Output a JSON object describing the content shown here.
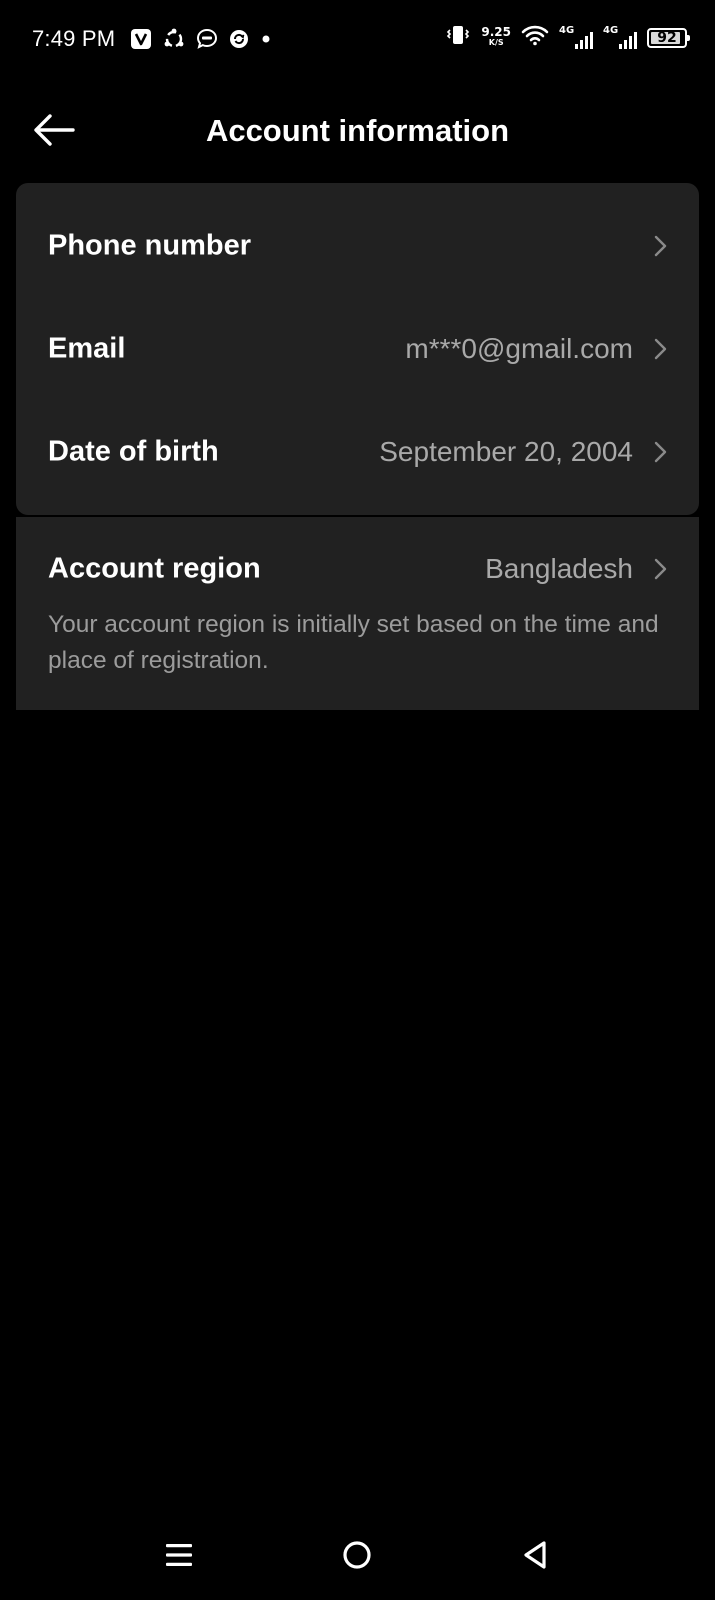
{
  "status_bar": {
    "time": "7:49 PM",
    "net_speed_value": "9.25",
    "net_speed_unit": "K/S",
    "network_type_1": "4G",
    "network_type_2": "4G",
    "battery_level": "92",
    "battery_fraction": 0.92
  },
  "header": {
    "title": "Account information",
    "back_icon": "arrow-left-icon"
  },
  "account": {
    "rows": [
      {
        "label": "Phone number",
        "value": ""
      },
      {
        "label": "Email",
        "value": "m***0@gmail.com"
      },
      {
        "label": "Date of birth",
        "value": "September 20, 2004"
      }
    ],
    "region": {
      "label": "Account region",
      "value": "Bangladesh",
      "note": "Your account region is initially set based on the time and place of registration."
    }
  },
  "nav": {
    "recents_icon": "menu-icon",
    "home_icon": "home-circle-icon",
    "back_icon": "back-triangle-icon"
  },
  "colors": {
    "background": "#000000",
    "card": "#212121",
    "primary_text": "#ffffff",
    "secondary_text": "#a9a9a9"
  }
}
